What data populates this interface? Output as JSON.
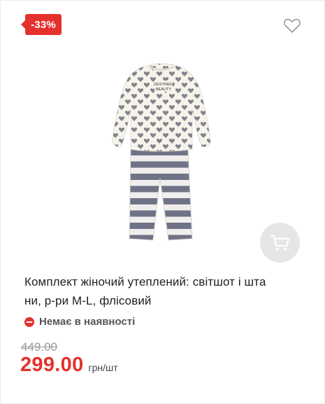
{
  "badge": {
    "discount": "-33%"
  },
  "product": {
    "title_line1": "Комплект жіночий утеплений: світшот і шта",
    "title_line2": "ни, р-ри M-L, флісовий",
    "image_text": "DESTINED BEAUTY"
  },
  "stock": {
    "status": "Немає в наявності"
  },
  "price": {
    "old": "449.00",
    "current": "299.00",
    "unit": "грн/шт"
  },
  "icons": {
    "favorite": "heart-outline-icon",
    "cart": "cart-icon",
    "stock": "minus-circle-icon"
  },
  "colors": {
    "accent": "#e5312d",
    "cart_bg": "#e6e6e6",
    "old_price": "#9a9a9a"
  }
}
